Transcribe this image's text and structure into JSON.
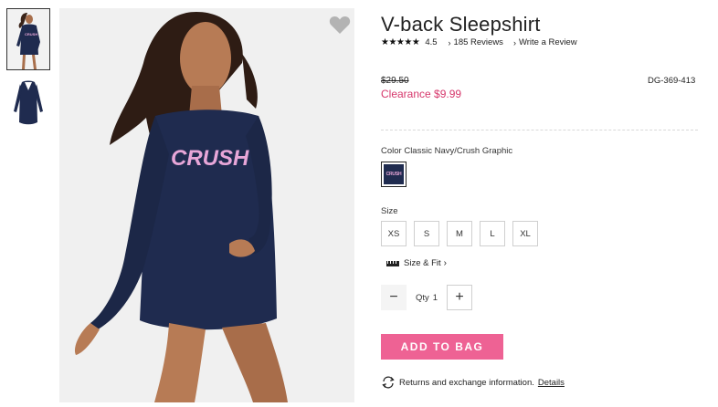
{
  "product": {
    "title": "V-back Sleepshirt",
    "rating_stars": "★★★★★",
    "rating_value": "4.5",
    "reviews_label": "185 Reviews",
    "write_review_label": "Write a Review",
    "original_price": "$29.50",
    "clearance_price": "Clearance $9.99",
    "sku": "DG-369-413",
    "graphic_text": "CRUSH"
  },
  "color": {
    "label": "Color Classic Navy/Crush Graphic",
    "swatch_hex": "#1f2b4f",
    "swatch_graphic": "CRUSH"
  },
  "size": {
    "label": "Size",
    "options": [
      "XS",
      "S",
      "M",
      "L",
      "XL"
    ],
    "fit_link": "Size & Fit"
  },
  "quantity": {
    "minus": "−",
    "label": "Qty",
    "value": "1",
    "plus": "+"
  },
  "actions": {
    "add_to_bag": "ADD TO BAG"
  },
  "returns": {
    "text": "Returns and exchange information.",
    "details_link": "Details"
  },
  "icons": {
    "wishlist": "heart-icon",
    "returns": "exchange-arrows-icon",
    "size_fit": "ruler-icon"
  },
  "colors": {
    "accent_pink": "#ee6294",
    "sale_red": "#d6366b",
    "garment_navy": "#1f2b4f",
    "graphic_pink": "#e7a6d8"
  }
}
